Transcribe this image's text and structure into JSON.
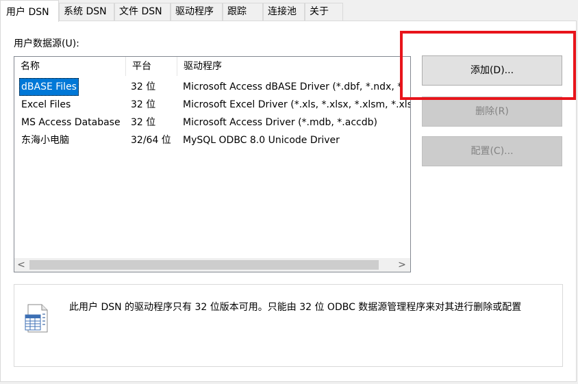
{
  "tabs": [
    {
      "label": "用户 DSN",
      "active": true
    },
    {
      "label": "系统 DSN",
      "active": false
    },
    {
      "label": "文件 DSN",
      "active": false
    },
    {
      "label": "驱动程序",
      "active": false
    },
    {
      "label": "跟踪",
      "active": false
    },
    {
      "label": "连接池",
      "active": false
    },
    {
      "label": "关于",
      "active": false
    }
  ],
  "list": {
    "label": "用户数据源(U):",
    "columns": [
      "名称",
      "平台",
      "驱动程序"
    ],
    "rows": [
      {
        "name": "dBASE Files",
        "platform": "32 位",
        "driver": "Microsoft Access dBASE Driver (*.dbf, *.ndx, *",
        "selected": true
      },
      {
        "name": "Excel Files",
        "platform": "32 位",
        "driver": "Microsoft Excel Driver (*.xls, *.xlsx, *.xlsm, *.xls",
        "selected": false
      },
      {
        "name": "MS Access Database",
        "platform": "32 位",
        "driver": "Microsoft Access Driver (*.mdb, *.accdb)",
        "selected": false
      },
      {
        "name": "东海小电脑",
        "platform": "32/64 位",
        "driver": "MySQL ODBC 8.0 Unicode Driver",
        "selected": false
      }
    ],
    "scroll_left": "<",
    "scroll_right": ">"
  },
  "buttons": {
    "add": "添加(D)...",
    "remove": "删除(R)",
    "configure": "配置(C)..."
  },
  "info": {
    "text": "此用户 DSN 的驱动程序只有 32 位版本可用。只能由 32 位 ODBC 数据源管理程序来对其进行删除或配置"
  },
  "colors": {
    "selection": "#0078d7",
    "highlight": "#e8141b"
  }
}
